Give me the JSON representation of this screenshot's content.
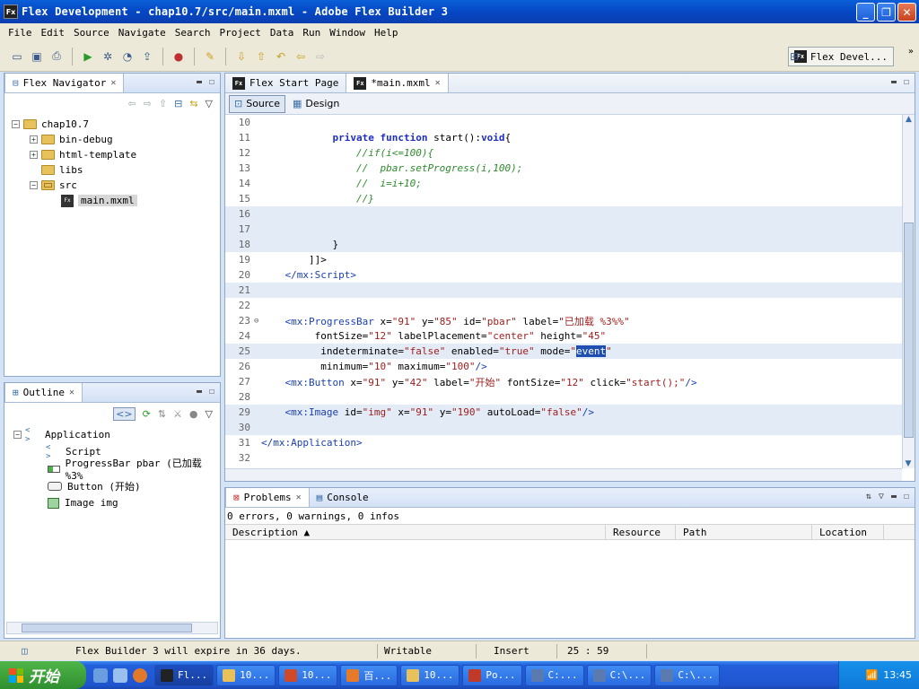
{
  "window": {
    "title": "Flex Development - chap10.7/src/main.mxml - Adobe Flex Builder 3",
    "app_icon_text": "Fx"
  },
  "menu": [
    "File",
    "Edit",
    "Source",
    "Navigate",
    "Search",
    "Project",
    "Data",
    "Run",
    "Window",
    "Help"
  ],
  "perspective": {
    "label": "Flex Devel..."
  },
  "navigator": {
    "tab_label": "Flex Navigator",
    "tree": [
      {
        "label": "chap10.7",
        "depth": 0,
        "expander": "−",
        "icon": "project"
      },
      {
        "label": "bin-debug",
        "depth": 1,
        "expander": "+",
        "icon": "folder"
      },
      {
        "label": "html-template",
        "depth": 1,
        "expander": "+",
        "icon": "folder"
      },
      {
        "label": "libs",
        "depth": 1,
        "expander": "",
        "icon": "folder"
      },
      {
        "label": "src",
        "depth": 1,
        "expander": "−",
        "icon": "src-folder"
      },
      {
        "label": "main.mxml",
        "depth": 2,
        "expander": "",
        "icon": "mxml",
        "selected": true
      }
    ]
  },
  "editor": {
    "tabs": [
      {
        "label": "Flex Start Page",
        "active": false
      },
      {
        "label": "*main.mxml",
        "active": true
      }
    ],
    "source_label": "Source",
    "design_label": "Design",
    "lines": [
      {
        "n": "10",
        "html": ""
      },
      {
        "n": "11",
        "html": "            <span class='kw'>private</span> <span class='kw'>function</span> start():<span class='kw'>void</span>{"
      },
      {
        "n": "12",
        "html": "                <span class='cm'>//if(i&lt;=100){</span>"
      },
      {
        "n": "13",
        "html": "                <span class='cm'>//  pbar.setProgress(i,100);</span>"
      },
      {
        "n": "14",
        "html": "                <span class='cm'>//  i=i+10;</span>"
      },
      {
        "n": "15",
        "html": "                <span class='cm'>//}</span>"
      },
      {
        "n": "16",
        "html": "",
        "hl": true
      },
      {
        "n": "17",
        "html": "",
        "hl": true
      },
      {
        "n": "18",
        "html": "            }",
        "hl": true
      },
      {
        "n": "19",
        "html": "        ]]>"
      },
      {
        "n": "20",
        "html": "    <span class='tag'>&lt;/mx:Script&gt;</span>"
      },
      {
        "n": "21",
        "html": "",
        "hl": true
      },
      {
        "n": "22",
        "html": ""
      },
      {
        "n": "23",
        "html": "    <span class='tag'>&lt;mx:ProgressBar</span> x=<span class='str'>\"91\"</span> y=<span class='str'>\"85\"</span> id=<span class='str'>\"pbar\"</span> label=<span class='str'>\"已加载 %3%%\"</span>",
        "fold": true
      },
      {
        "n": "24",
        "html": "         fontSize=<span class='str'>\"12\"</span> labelPlacement=<span class='str'>\"center\"</span> height=<span class='str'>\"45\"</span>"
      },
      {
        "n": "25",
        "html": "          indeterminate=<span class='str'>\"false\"</span> enabled=<span class='str'>\"true\"</span> mode=<span class='str'>\"<span class='selword'>event</span>\"</span>",
        "hl": true
      },
      {
        "n": "26",
        "html": "          minimum=<span class='str'>\"10\"</span> maximum=<span class='str'>\"100\"</span><span class='tag'>/&gt;</span>"
      },
      {
        "n": "27",
        "html": "    <span class='tag'>&lt;mx:Button</span> x=<span class='str'>\"91\"</span> y=<span class='str'>\"42\"</span> label=<span class='str'>\"开始\"</span> fontSize=<span class='str'>\"12\"</span> click=<span class='str'>\"start();\"</span><span class='tag'>/&gt;</span>"
      },
      {
        "n": "28",
        "html": ""
      },
      {
        "n": "29",
        "html": "    <span class='tag'>&lt;mx:Image</span> id=<span class='str'>\"img\"</span> x=<span class='str'>\"91\"</span> y=<span class='str'>\"190\"</span> autoLoad=<span class='str'>\"false\"</span><span class='tag'>/&gt;</span>",
        "hl": true
      },
      {
        "n": "30",
        "html": "",
        "hl": true
      },
      {
        "n": "31",
        "html": "<span class='tag'>&lt;/mx:Application&gt;</span>"
      },
      {
        "n": "32",
        "html": ""
      }
    ]
  },
  "outline": {
    "tab_label": "Outline",
    "items": [
      {
        "label": "Application",
        "depth": 0,
        "icon": "tag"
      },
      {
        "label": "Script",
        "depth": 1,
        "icon": "tag"
      },
      {
        "label": "ProgressBar pbar (已加载 %3%",
        "depth": 1,
        "icon": "pb"
      },
      {
        "label": "Button (开始)",
        "depth": 1,
        "icon": "btn"
      },
      {
        "label": "Image img",
        "depth": 1,
        "icon": "img"
      }
    ]
  },
  "problems": {
    "tab_label": "Problems",
    "console_label": "Console",
    "summary": "0 errors, 0 warnings, 0 infos",
    "columns": [
      "Description",
      "Resource",
      "Path",
      "Location"
    ]
  },
  "status": {
    "message": "Flex Builder 3 will expire in 36 days.",
    "writable": "Writable",
    "insert": "Insert",
    "position": "25 : 59"
  },
  "taskbar": {
    "start_label": "开始",
    "tasks": [
      {
        "label": "Fl...",
        "active": true,
        "color": "#222222"
      },
      {
        "label": "10...",
        "color": "#e8c15a"
      },
      {
        "label": "10...",
        "color": "#d04a2a"
      },
      {
        "label": "百...",
        "color": "#e57a2a"
      },
      {
        "label": "10...",
        "color": "#e8c15a"
      },
      {
        "label": "Po...",
        "color": "#c03a2a"
      },
      {
        "label": "C:...",
        "color": "#5a7ab0"
      },
      {
        "label": "C:\\...",
        "color": "#5a7ab0"
      },
      {
        "label": "C:\\...",
        "color": "#5a7ab0"
      }
    ],
    "clock": "13:45"
  }
}
